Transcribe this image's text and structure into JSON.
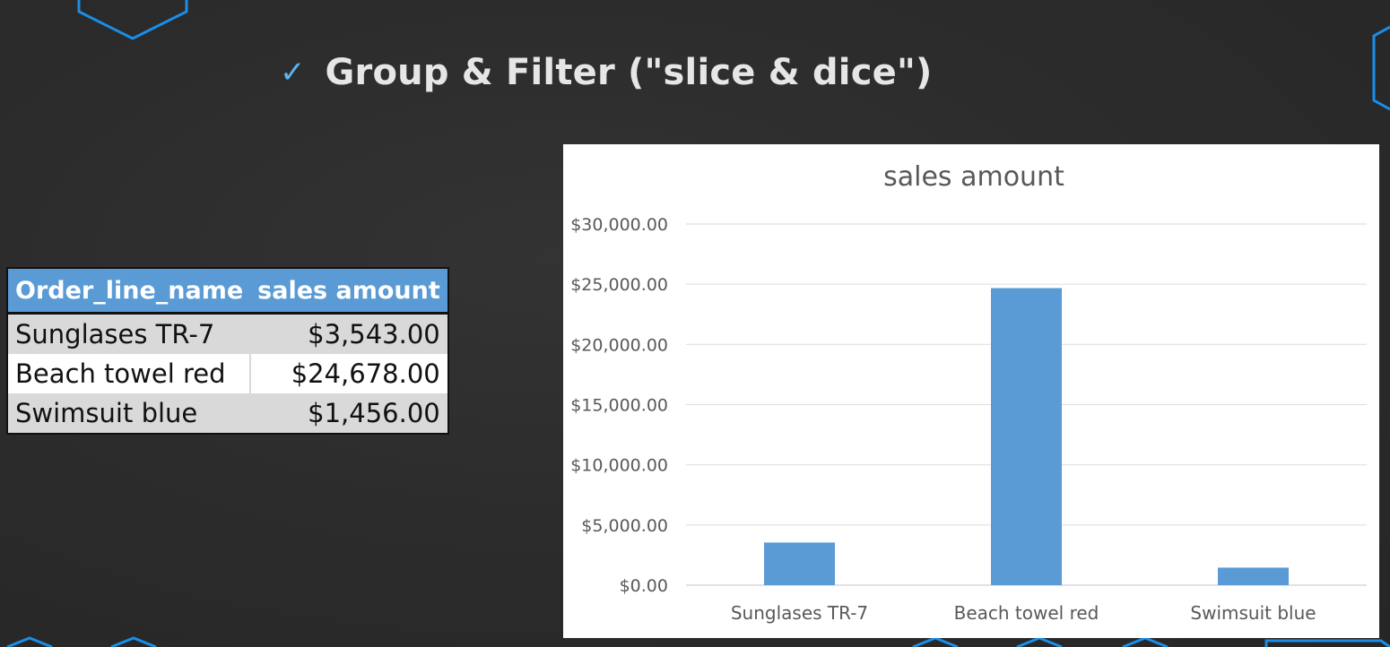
{
  "heading": {
    "check_icon": "checkmark-icon",
    "text": "Group & Filter (\"slice & dice\")"
  },
  "table": {
    "headers": [
      "Order_line_name",
      "sales amount"
    ],
    "rows": [
      [
        "Sunglases TR-7",
        "$3,543.00"
      ],
      [
        "Beach towel red",
        "$24,678.00"
      ],
      [
        "Swimsuit blue",
        "$1,456.00"
      ]
    ]
  },
  "colors": {
    "accent": "#5ab4f0",
    "table_header": "#5b9bd5",
    "bar": "#5b9bd5"
  },
  "chart_data": {
    "type": "bar",
    "title": "sales amount",
    "categories": [
      "Sunglases TR-7",
      "Beach towel red",
      "Swimsuit blue"
    ],
    "values": [
      3543,
      24678,
      1456
    ],
    "ylim": [
      0,
      30000
    ],
    "yticks": [
      "$0.00",
      "$5,000.00",
      "$10,000.00",
      "$15,000.00",
      "$20,000.00",
      "$25,000.00",
      "$30,000.00"
    ],
    "ytick_values": [
      0,
      5000,
      10000,
      15000,
      20000,
      25000,
      30000
    ],
    "grid": true,
    "legend": "none"
  }
}
